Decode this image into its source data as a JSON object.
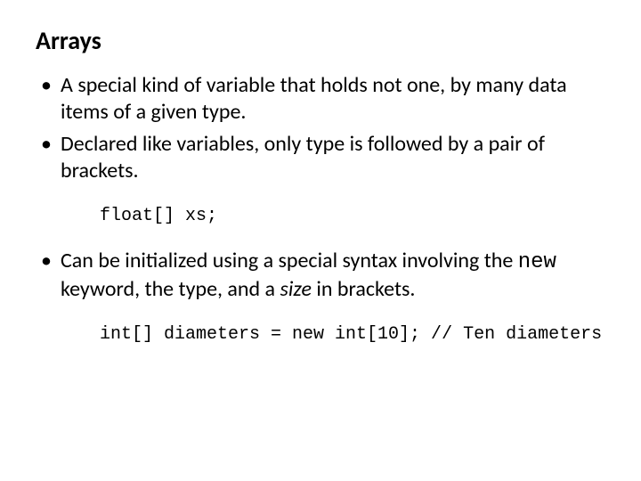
{
  "title": "Arrays",
  "bullets": {
    "b1": "A special kind of variable that holds not one, by many data items of a given type.",
    "b2": "Declared like variables, only type is followed by a pair of brackets.",
    "b3_pre": "Can be initialized using a special syntax involving the ",
    "b3_kw": "new",
    "b3_mid": " keyword, the type, and a ",
    "b3_size": "size",
    "b3_post": " in brackets."
  },
  "code": {
    "c1": "float[] xs;",
    "c2": "int[] diameters = new int[10]; // Ten diameters"
  }
}
